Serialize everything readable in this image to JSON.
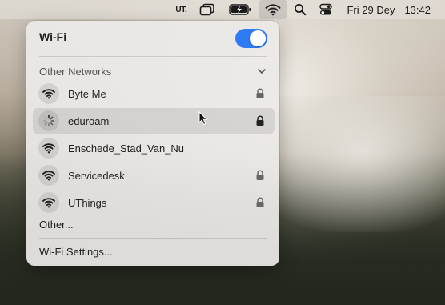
{
  "menubar": {
    "input_source": "UT.",
    "date": "Fri 29 Dey",
    "time": "13:42",
    "icons": [
      "input-source",
      "window-stack-icon",
      "battery-charging-icon",
      "wifi-icon",
      "search-icon",
      "control-center-icon"
    ]
  },
  "wifi_panel": {
    "title": "Wi-Fi",
    "toggle_on": true,
    "section_title": "Other Networks",
    "networks": [
      {
        "name": "Byte Me",
        "locked": true,
        "state": "idle"
      },
      {
        "name": "eduroam",
        "locked": true,
        "state": "connecting"
      },
      {
        "name": "Enschede_Stad_Van_Nu",
        "locked": false,
        "state": "idle"
      },
      {
        "name": "Servicedesk",
        "locked": true,
        "state": "idle"
      },
      {
        "name": "UThings",
        "locked": true,
        "state": "idle"
      }
    ],
    "other_label": "Other...",
    "settings_label": "Wi-Fi Settings...",
    "accent_color": "#2f7bf5"
  }
}
